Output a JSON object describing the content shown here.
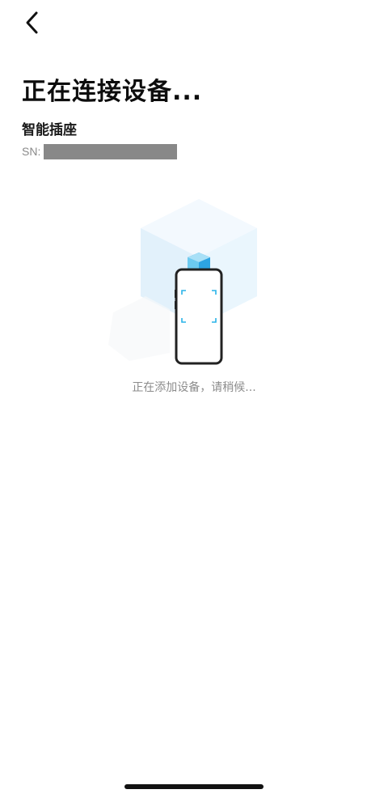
{
  "nav": {
    "back_icon": "chevron-left-icon"
  },
  "header": {
    "title": "正在连接设备..."
  },
  "device": {
    "name": "智能插座",
    "sn_label": "SN:",
    "sn_redacted": true
  },
  "status": {
    "message": "正在添加设备，请稍候..."
  },
  "illustration": {
    "icons": [
      "cube-icon",
      "phone-icon",
      "device-icon",
      "scan-frame-icon"
    ],
    "accent_color": "#29b3e8",
    "cube_color": "#dff0fb"
  }
}
